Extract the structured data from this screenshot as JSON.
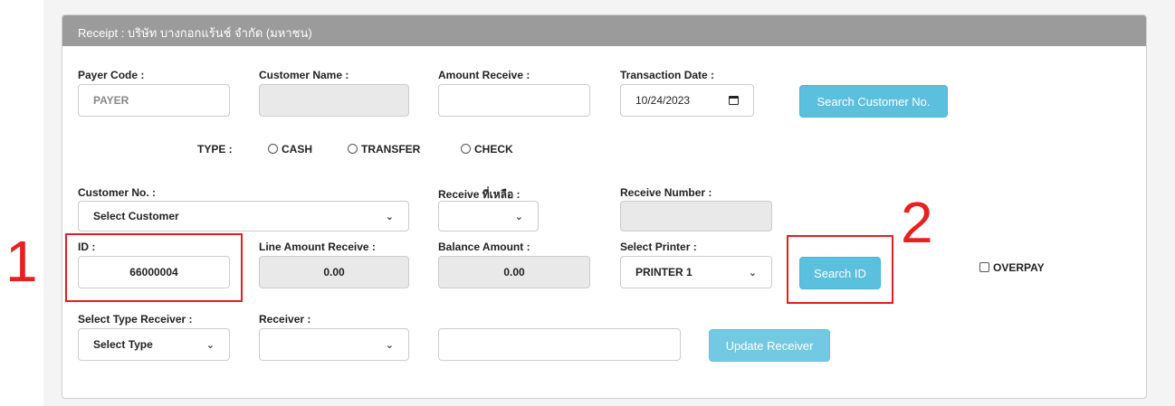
{
  "panel": {
    "title": "Receipt : บริษัท บางกอกแร้นช์ จำกัด (มหาชน)"
  },
  "payer_code": {
    "label": "Payer Code :",
    "placeholder": "PAYER"
  },
  "customer_name": {
    "label": "Customer Name :",
    "value": ""
  },
  "amount_receive": {
    "label": "Amount Receive :",
    "value": ""
  },
  "transaction_date": {
    "label": "Transaction Date :",
    "value": "10/24/2023"
  },
  "search_customer_button": "Search Customer No.",
  "type": {
    "label": "TYPE :",
    "options": [
      "CASH",
      "TRANSFER",
      "CHECK"
    ]
  },
  "customer_no": {
    "label": "Customer No. :",
    "selected": "Select Customer"
  },
  "receive_remaining": {
    "label": "Receive ที่เหลือ :",
    "selected": ""
  },
  "receive_number": {
    "label": "Receive Number :",
    "value": ""
  },
  "id_field": {
    "label": "ID :",
    "value": "66000004"
  },
  "line_amount_receive": {
    "label": "Line Amount Receive :",
    "value": "0.00"
  },
  "balance_amount": {
    "label": "Balance Amount :",
    "value": "0.00"
  },
  "select_printer": {
    "label": "Select Printer :",
    "selected": "PRINTER 1"
  },
  "search_id_button": "Search ID",
  "overpay": {
    "label": "OVERPAY",
    "checked": false
  },
  "select_type_receiver": {
    "label": "Select Type Receiver :",
    "selected": "Select Type"
  },
  "receiver": {
    "label": "Receiver :",
    "selected": ""
  },
  "receiver_text": {
    "value": ""
  },
  "update_receiver_button": "Update Receiver",
  "annotations": {
    "one": "1",
    "two": "2"
  },
  "colors": {
    "header": "#9b9b9b",
    "button": "#5bc0de",
    "annotation": "#e02020"
  }
}
